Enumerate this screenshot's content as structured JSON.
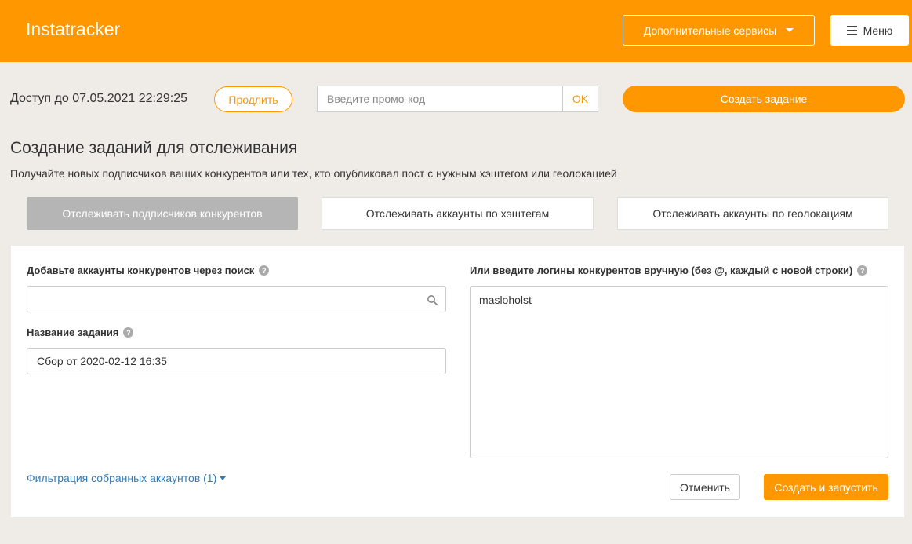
{
  "header": {
    "brand": "Instatracker",
    "services_label": "Дополнительные сервисы",
    "menu_label": "Меню"
  },
  "account": {
    "access_text": "Доступ до 07.05.2021 22:29:25",
    "extend_label": "Продлить",
    "promo_placeholder": "Введите промо-код",
    "ok_label": "OK",
    "create_task_label": "Создать задание"
  },
  "page": {
    "title": "Создание заданий для отслеживания",
    "subtitle": "Получайте новых подписчиков ваших конкурентов или тех, кто опубликовал пост с нужным хэштегом или геолокацией"
  },
  "tabs": [
    {
      "label": "Отслеживать подписчиков конкурентов",
      "active": true
    },
    {
      "label": "Отслеживать аккаунты по хэштегам",
      "active": false
    },
    {
      "label": "Отслеживать аккаунты по геолокациям",
      "active": false
    }
  ],
  "form": {
    "search_label": "Добавьте аккаунты конкурентов через поиск",
    "search_value": "",
    "name_label": "Название задания",
    "name_value": "Сбор от 2020-02-12 16:35",
    "manual_label": "Или введите логины конкурентов вручную (без @, каждый с новой строки)",
    "manual_value": "masloholst",
    "filter_link": "Фильтрация собранных аккаунтов (1)",
    "cancel_label": "Отменить",
    "start_label": "Создать и запустить",
    "help_glyph": "?"
  },
  "colors": {
    "accent": "#ff9800",
    "link": "#337ab7",
    "background": "#efece8",
    "active_tab": "#b5b5b5"
  },
  "icons": [
    "chevron-down-icon",
    "hamburger-icon",
    "help-icon",
    "search-icon"
  ]
}
